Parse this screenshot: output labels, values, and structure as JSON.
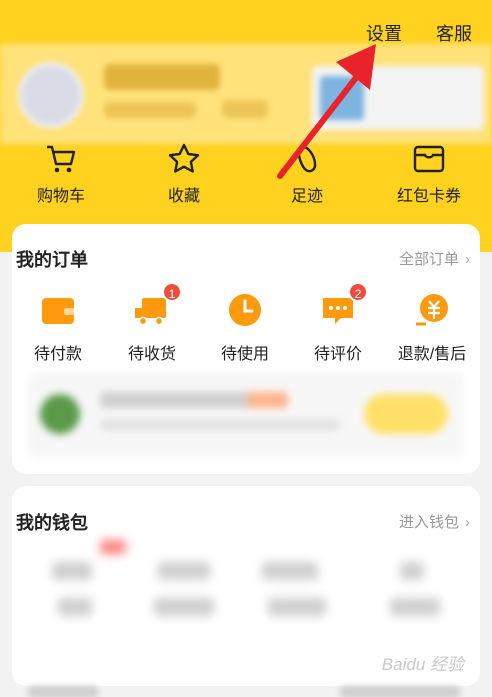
{
  "header": {
    "settings_label": "设置",
    "service_label": "客服"
  },
  "quick_links": [
    {
      "label": "购物车",
      "icon": "cart-icon"
    },
    {
      "label": "收藏",
      "icon": "star-icon"
    },
    {
      "label": "足迹",
      "icon": "footprint-icon"
    },
    {
      "label": "红包卡券",
      "icon": "coupon-icon"
    }
  ],
  "orders": {
    "title": "我的订单",
    "all_label": "全部订单",
    "items": [
      {
        "label": "待付款",
        "icon": "wallet-icon",
        "badge": ""
      },
      {
        "label": "待收货",
        "icon": "truck-icon",
        "badge": "1"
      },
      {
        "label": "待使用",
        "icon": "clock-icon",
        "badge": ""
      },
      {
        "label": "待评价",
        "icon": "comment-icon",
        "badge": "2"
      },
      {
        "label": "退款/售后",
        "icon": "refund-icon",
        "badge": ""
      }
    ]
  },
  "wallet": {
    "title": "我的钱包",
    "enter_label": "进入钱包"
  },
  "watermark": "Baidu 经验",
  "colors": {
    "brand_yellow": "#ffd21f",
    "accent_orange": "#ff9a0e",
    "badge_red": "#f24b3b",
    "arrow_red": "#e8232a"
  }
}
